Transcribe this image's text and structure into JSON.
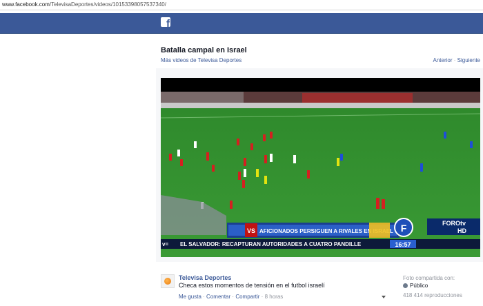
{
  "browser": {
    "url_host": "www.facebook.com",
    "url_path": "/TelevisaDeportes/videos/10153398057537340/"
  },
  "header": {
    "logo_icon": "facebook-f-icon",
    "brand_color": "#3b5998"
  },
  "video_page": {
    "title": "Batalla campal en Israel",
    "more_videos_link": "Más videos de Televisa Deportes",
    "prev_link": "Anterior",
    "separator": "·",
    "next_link": "Siguiente"
  },
  "video": {
    "banner_tag": "VS",
    "banner_text": "AFICIONADOS PERSIGUEN A RIVALES EN ISRAEL",
    "ticker_prefix": "v=",
    "ticker_text": "EL SALVADOR: RECAPTURAN AUTORIDADES A CUATRO PANDILLE",
    "clock": "16:57",
    "channel_logo_line1": "FOROtv",
    "channel_logo_line2": "HD",
    "channel_badge_letter": "F"
  },
  "post": {
    "page_name": "Televisa Deportes",
    "description": "Checa estos momentos de tensión en el futbol israelí",
    "like_action": "Me gusta",
    "comment_action": "Comentar",
    "share_action": "Compartir",
    "dot": "·",
    "time_ago": "8 horas"
  },
  "sidebar_meta": {
    "shared_label": "Foto compartida con:",
    "privacy": "Público",
    "views": "418 414 reproducciones"
  }
}
